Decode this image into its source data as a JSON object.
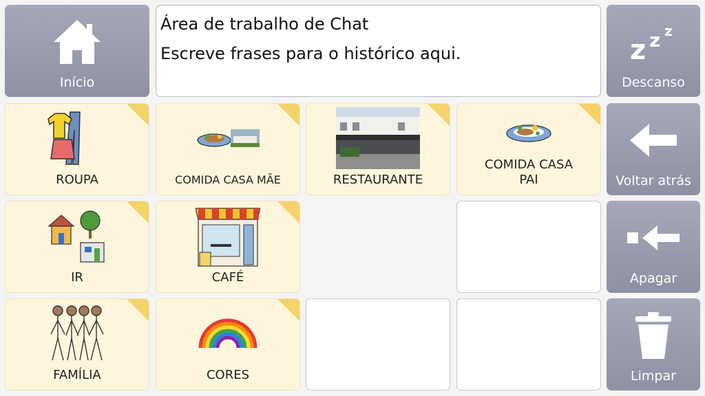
{
  "chat": {
    "title": "Área de trabalho de Chat",
    "hint": "Escreve frases para o histórico aqui."
  },
  "system": {
    "home": {
      "label": "Início",
      "icon": "home-icon"
    },
    "rest": {
      "label": "Descanso",
      "icon": "sleep-zzz-icon"
    },
    "back": {
      "label": "Voltar atrás",
      "icon": "arrow-left-icon"
    },
    "erase": {
      "label": "Apagar",
      "icon": "backspace-icon"
    },
    "clear": {
      "label": "Limpar",
      "icon": "trash-icon"
    }
  },
  "tiles": {
    "roupa": {
      "label": "ROUPA",
      "icon": "clothes-icon"
    },
    "comida_mae": {
      "label": "COMIDA CASA MÃE",
      "icon": "food-house-icon"
    },
    "restaurante": {
      "label": "RESTAURANTE",
      "icon": "restaurant-photo"
    },
    "comida_pai": {
      "label": "COMIDA CASA PAI",
      "icon": "food-plate-icon"
    },
    "ir": {
      "label": "IR",
      "icon": "go-places-icon"
    },
    "cafe": {
      "label": "CAFÉ",
      "icon": "cafe-icon"
    },
    "familia": {
      "label": "FAMÍLIA",
      "icon": "family-icon"
    },
    "cores": {
      "label": "CORES",
      "icon": "rainbow-icon"
    }
  },
  "colors": {
    "system_tile": "#9a9daf",
    "folder_tile": "#fdf6dc",
    "folder_corner": "#f3d36a"
  }
}
